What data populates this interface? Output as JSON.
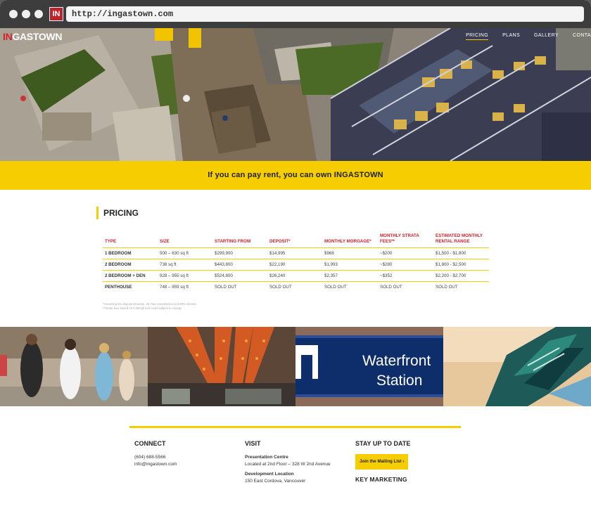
{
  "browser": {
    "url": "http://ingastown.com",
    "favicon": "IN"
  },
  "header": {
    "logo_prefix": "IN",
    "logo_suffix": "GASTOWN",
    "nav": [
      "PRICING",
      "PLANS",
      "GALLERY",
      "CONTA"
    ]
  },
  "banner": {
    "text": "If you can pay rent, you can own INGASTOWN"
  },
  "pricing": {
    "title": "PRICING",
    "headers": [
      "TYPE",
      "SIZE",
      "STARTING FROM",
      "DEPOSIT*",
      "MONTHLY MORGAGE*",
      "MONTHLY STRATA FEES**",
      "ESTIMATED MONTHLY RENTAL RANGE"
    ],
    "rows": [
      [
        "1 BEDROOM",
        "500 – 630 sq ft",
        "$299,900",
        "$14,995",
        "$968",
        "~$200",
        "$1,500 - $1,800"
      ],
      [
        "2 BEDROOM",
        "738 sq ft",
        "$443,800",
        "$22,190",
        "$1,993",
        "~$280",
        "$1,800 - $2,500"
      ],
      [
        "2 BEDROOM + DEN",
        "928 – 955 sq ft",
        "$524,800",
        "$26,240",
        "$2,357",
        "~$352",
        "$2,200 - $2,700"
      ],
      [
        "PENTHOUSE",
        "748 – 959 sq ft",
        "SOLD OUT",
        "SOLD OUT",
        "SOLD OUT",
        "SOLD OUT",
        "SOLD OUT"
      ]
    ],
    "notes": [
      "*Assuming 5% deposit structure, 25 Year Amortization at 3.89% interest",
      "**Strata fees based on 0.38/sqft and could subject to change"
    ]
  },
  "photos": {
    "sign_line1": "Waterfront",
    "sign_line2": "Station"
  },
  "footer": {
    "connect": {
      "title": "CONNECT",
      "phone": "(604) 688-5566",
      "email": "info@ingastown.com"
    },
    "visit": {
      "title": "VISIT",
      "centre_label": "Presentation Centre",
      "centre_address": "Located at 2nd Floor – 328 W 2nd Avenue",
      "dev_label": "Development Location",
      "dev_address": "150 East Cordova, Vancouver"
    },
    "stay": {
      "title": "STAY UP TO DATE",
      "button": "Join the Mailing List ›",
      "brand": "KEY MARKETING"
    }
  },
  "colors": {
    "accent": "#f6ce00",
    "brand_red": "#cc1f2a",
    "chrome": "#3d3d3d"
  }
}
